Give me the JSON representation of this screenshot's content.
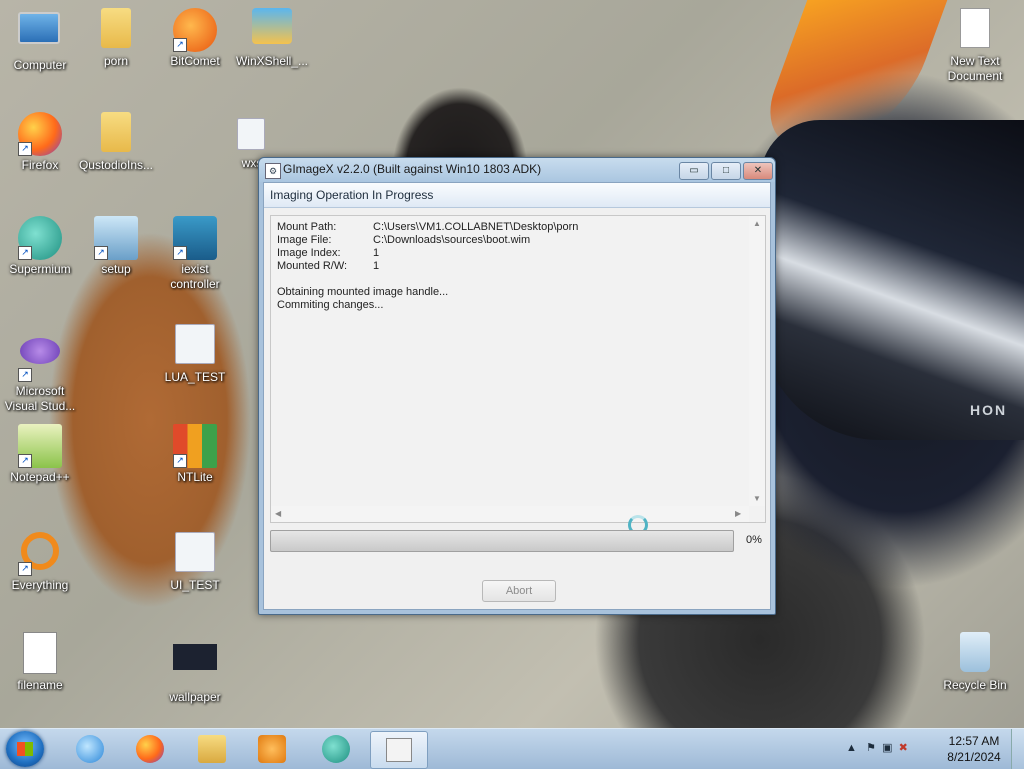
{
  "desktop": {
    "icons": [
      {
        "label": "Computer",
        "icon": "computer-icon"
      },
      {
        "label": "porn",
        "icon": "folder-icon"
      },
      {
        "label": "BitComet",
        "icon": "bitcomet-icon"
      },
      {
        "label": "WinXShell_...",
        "icon": "winxshell-icon"
      },
      {
        "label": "Firefox",
        "icon": "firefox-icon"
      },
      {
        "label": "QustodioIns...",
        "icon": "folder-icon"
      },
      {
        "label": "wxs",
        "icon": "gear-file-icon"
      },
      {
        "label": "Supermium",
        "icon": "supermium-icon"
      },
      {
        "label": "setup",
        "icon": "setup-icon"
      },
      {
        "label": "iexist controller",
        "icon": "iexist-icon"
      },
      {
        "label": "Microsoft Visual Stud...",
        "icon": "visual-studio-icon"
      },
      {
        "label": "LUA_TEST",
        "icon": "gear-file-icon"
      },
      {
        "label": "Notepad++",
        "icon": "notepadpp-icon"
      },
      {
        "label": "NTLite",
        "icon": "ntlite-icon"
      },
      {
        "label": "Everything",
        "icon": "everything-icon"
      },
      {
        "label": "UI_TEST",
        "icon": "gear-file-icon"
      },
      {
        "label": "filename",
        "icon": "script-file-icon"
      },
      {
        "label": "wallpaper",
        "icon": "image-file-icon"
      },
      {
        "label": "New Text Document",
        "icon": "text-file-icon"
      },
      {
        "label": "Recycle Bin",
        "icon": "recycle-bin-icon"
      }
    ],
    "wallpaper_text": "HON"
  },
  "window": {
    "title": "GImageX v2.2.0 (Built against Win10 1803 ADK)",
    "app_icon": "gimagex-icon",
    "header": "Imaging Operation In Progress",
    "details": [
      {
        "key": "Mount Path:",
        "value": "C:\\Users\\VM1.COLLABNET\\Desktop\\porn"
      },
      {
        "key": "Image File:",
        "value": "C:\\Downloads\\sources\\boot.wim"
      },
      {
        "key": "Image Index:",
        "value": "1"
      },
      {
        "key": "Mounted R/W:",
        "value": "1"
      }
    ],
    "log_lines": [
      "Obtaining mounted image handle...",
      "Commiting changes..."
    ],
    "progress_percent": 0,
    "progress_label": "0%",
    "abort_label": "Abort",
    "minimize_symbol": "▭",
    "maximize_symbol": "□",
    "close_symbol": "✕"
  },
  "taskbar": {
    "pinned": [
      {
        "name": "internet-explorer-icon"
      },
      {
        "name": "firefox-icon"
      },
      {
        "name": "explorer-icon"
      },
      {
        "name": "media-player-icon"
      },
      {
        "name": "supermium-icon"
      },
      {
        "name": "gimagex-icon",
        "active": true
      }
    ],
    "clock_time": "12:57 AM",
    "clock_date": "8/21/2024",
    "tray_icons": [
      "show-hidden-icons-icon",
      "action-center-flag-icon",
      "network-icon",
      "volume-muted-icon"
    ]
  },
  "colors": {
    "progress_fill": "#28b028",
    "titlebar": "#aac6e0",
    "taskbar": "#9eb9d6"
  }
}
